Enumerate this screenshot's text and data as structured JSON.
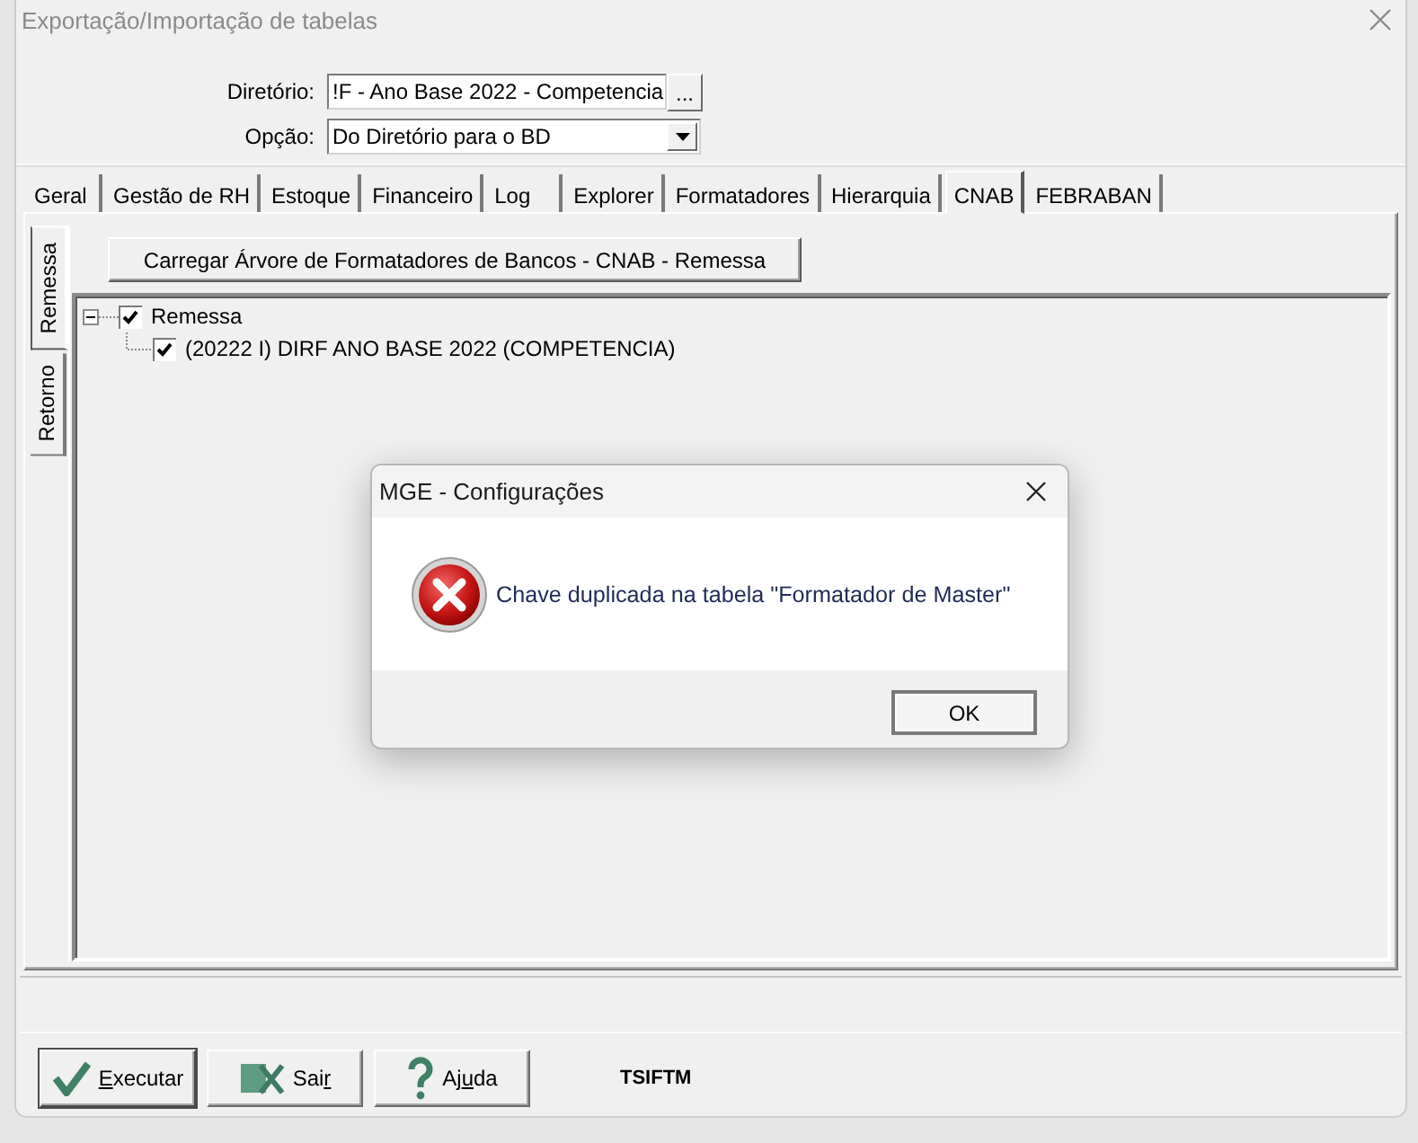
{
  "window": {
    "title": "Exportação/Importação de tabelas"
  },
  "form": {
    "fields": [
      {
        "label": "Diretório:",
        "kind": "text",
        "value": "!F - Ano Base 2022 - Competencia",
        "browse": "..."
      },
      {
        "label": "Opção:",
        "kind": "select",
        "value": "Do Diretório para o BD"
      }
    ]
  },
  "tabs": [
    {
      "label": "Geral",
      "selected": false
    },
    {
      "label": "Gestão de RH",
      "selected": false
    },
    {
      "label": "Estoque",
      "selected": false
    },
    {
      "label": "Financeiro",
      "selected": false
    },
    {
      "label": "Log",
      "selected": false
    },
    {
      "label": "Explorer",
      "selected": false
    },
    {
      "label": "Formatadores",
      "selected": false
    },
    {
      "label": "Hierarquia",
      "selected": false
    },
    {
      "label": "CNAB",
      "selected": true
    },
    {
      "label": "FEBRABAN",
      "selected": false
    }
  ],
  "side_tabs": [
    {
      "label": "Remessa",
      "selected": true
    },
    {
      "label": "Retorno",
      "selected": false
    }
  ],
  "load_button": "Carregar Árvore de Formatadores de Bancos - CNAB - Remessa",
  "tree": [
    {
      "label": "Remessa",
      "checked": true,
      "expanded": true,
      "children": [
        {
          "label": "(20222 I) DIRF ANO BASE 2022 (COMPETENCIA)",
          "checked": true
        }
      ]
    }
  ],
  "buttons": [
    {
      "kind": "execute",
      "default": true,
      "label_parts": [
        {
          "text": "E",
          "underline": true
        },
        {
          "text": "xecutar",
          "underline": false
        }
      ]
    },
    {
      "kind": "exit",
      "default": false,
      "label_parts": [
        {
          "text": "Sai",
          "underline": false
        },
        {
          "text": "r",
          "underline": true
        }
      ]
    },
    {
      "kind": "help",
      "default": false,
      "label_parts": [
        {
          "text": "Aj",
          "underline": false
        },
        {
          "text": "u",
          "underline": true
        },
        {
          "text": "da",
          "underline": false
        }
      ]
    }
  ],
  "program_code": "TSIFTM",
  "dialog": {
    "title": "MGE - Configurações",
    "kind": "error",
    "message": "Chave duplicada na tabela \"Formatador de Master\"",
    "buttons": [
      "OK"
    ]
  }
}
